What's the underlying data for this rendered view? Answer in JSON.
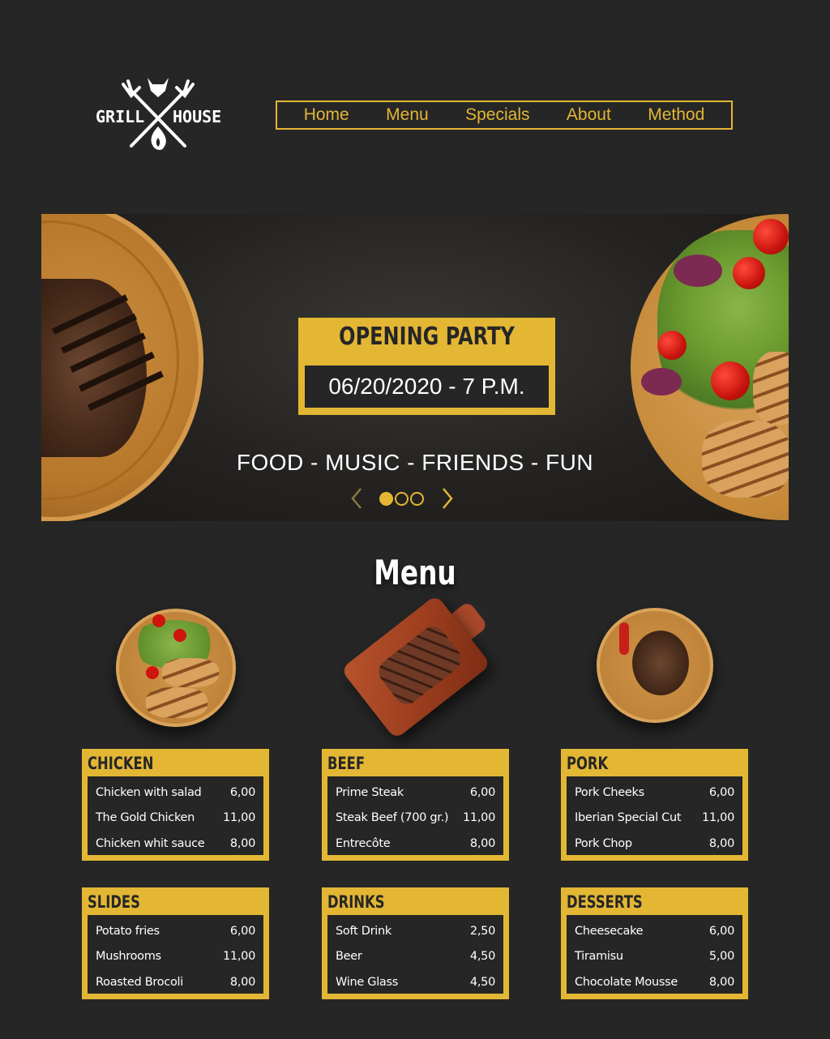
{
  "brand": {
    "left": "GRILL",
    "right": "HOUSE"
  },
  "nav": [
    "Home",
    "Menu",
    "Specials",
    "About",
    "Method"
  ],
  "hero": {
    "title": "OPENING PARTY",
    "date": "06/20/2020 - 7 P.M.",
    "tagline": "FOOD - MUSIC - FRIENDS - FUN",
    "slides_total": 3,
    "active_slide": 1
  },
  "menu": {
    "title": "Menu",
    "categories": [
      {
        "name": "CHICKEN",
        "items": [
          {
            "name": "Chicken with salad",
            "price": "6,00"
          },
          {
            "name": "The Gold Chicken",
            "price": "11,00"
          },
          {
            "name": "Chicken whit sauce",
            "price": "8,00"
          }
        ]
      },
      {
        "name": "BEEF",
        "items": [
          {
            "name": "Prime Steak",
            "price": "6,00"
          },
          {
            "name": "Steak Beef (700 gr.)",
            "price": "11,00"
          },
          {
            "name": "Entrecôte",
            "price": "8,00"
          }
        ]
      },
      {
        "name": "PORK",
        "items": [
          {
            "name": "Pork Cheeks",
            "price": "6,00"
          },
          {
            "name": "Iberian Special Cut",
            "price": "11,00"
          },
          {
            "name": "Pork Chop",
            "price": "8,00"
          }
        ]
      },
      {
        "name": "SLIDES",
        "items": [
          {
            "name": "Potato fries",
            "price": "6,00"
          },
          {
            "name": "Mushrooms",
            "price": "11,00"
          },
          {
            "name": "Roasted Brocoli",
            "price": "8,00"
          }
        ]
      },
      {
        "name": "DRINKS",
        "items": [
          {
            "name": "Soft Drink",
            "price": "2,50"
          },
          {
            "name": "Beer",
            "price": "4,50"
          },
          {
            "name": "Wine Glass",
            "price": "4,50"
          }
        ]
      },
      {
        "name": "DESSERTS",
        "items": [
          {
            "name": "Cheesecake",
            "price": "6,00"
          },
          {
            "name": "Tiramisu",
            "price": "5,00"
          },
          {
            "name": "Chocolate Mousse",
            "price": "8,00"
          }
        ]
      }
    ]
  },
  "colors": {
    "accent": "#e3b734",
    "background": "#262626",
    "text": "#ffffff"
  },
  "icons": [
    "grill-house-logo",
    "chevron-left-icon",
    "chevron-right-icon",
    "slide-dot-icon"
  ]
}
